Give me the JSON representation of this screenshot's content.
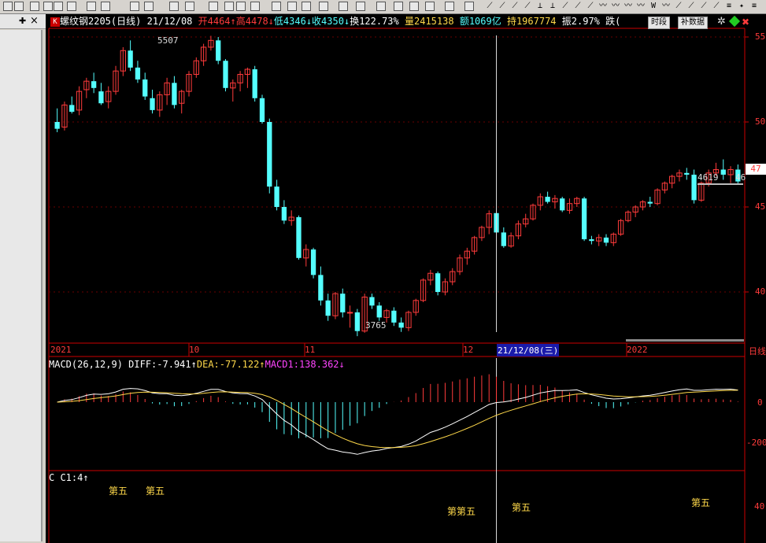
{
  "panel": {
    "pin_icon": "pin-icon",
    "close_label": "×"
  },
  "info_bar": {
    "k_badge": "K",
    "symbol": "螺纹钢2205(日线)",
    "date": "21/12/08",
    "open": "开4464",
    "open_arrow": "↑",
    "high": "高4478",
    "high_arrow": "↓",
    "low": "低4346",
    "low_arrow": "↓",
    "close": "收4350",
    "close_arrow": "↓",
    "turnover_rate": "换122.73%",
    "volume": "量2415138",
    "amount": "额1069亿",
    "open_interest": "持1967774",
    "amplitude": "振2.97%",
    "change": "跌(",
    "timeshare_btn": "时段",
    "supplement_btn": "补数据",
    "colors": {
      "up": "#ff3b3b",
      "down": "#54ffff",
      "text": "#e0e0e0",
      "highlight": "#ffd94a"
    }
  },
  "price_axis": {
    "labels": [
      "55",
      "50",
      "47",
      "45",
      "40"
    ],
    "current_price_label": "47"
  },
  "annotations": {
    "high_marker": "5507",
    "low_marker": "3765",
    "right_marker1": "4619",
    "right_marker2": "46"
  },
  "date_axis": {
    "labels": [
      "2021",
      "10",
      "11",
      "12",
      "21/12/08(三)",
      "2022"
    ],
    "right_label": "日线"
  },
  "macd": {
    "legend_name": "MACD(26,12,9)",
    "diff": "DIFF:-7.941",
    "diff_arrow": "↑",
    "dea": "DEA:-77.122",
    "dea_arrow": "↑",
    "macd1": "MACD1:138.362",
    "macd1_arrow": "↓",
    "axis_labels": [
      "0",
      "-200"
    ]
  },
  "c_indicator": {
    "legend": "C C1:4",
    "legend_arrow": "↑",
    "signal_text": "第五",
    "signal_overlap": "第第五",
    "axis_labels": [
      "40"
    ]
  },
  "chart_data": {
    "type": "candlestick",
    "title": "螺纹钢2205(日线)",
    "ylim": [
      3700,
      5600
    ],
    "marked_high": 5507,
    "marked_low": 3765,
    "selected_date": "21/12/08",
    "selected_bar": {
      "open": 4464,
      "high": 4478,
      "low": 4346,
      "close": 4350
    },
    "candles": [
      [
        5000,
        5080,
        4940,
        4960
      ],
      [
        4970,
        5120,
        4950,
        5100
      ],
      [
        5100,
        5150,
        5050,
        5060
      ],
      [
        5070,
        5210,
        5040,
        5180
      ],
      [
        5190,
        5260,
        5140,
        5240
      ],
      [
        5240,
        5290,
        5170,
        5200
      ],
      [
        5180,
        5230,
        5100,
        5110
      ],
      [
        5120,
        5210,
        5080,
        5180
      ],
      [
        5180,
        5330,
        5160,
        5300
      ],
      [
        5300,
        5440,
        5270,
        5420
      ],
      [
        5420,
        5480,
        5300,
        5320
      ],
      [
        5320,
        5360,
        5230,
        5250
      ],
      [
        5250,
        5290,
        5130,
        5150
      ],
      [
        5140,
        5190,
        5050,
        5070
      ],
      [
        5070,
        5180,
        5030,
        5160
      ],
      [
        5160,
        5260,
        5100,
        5230
      ],
      [
        5230,
        5270,
        5080,
        5100
      ],
      [
        5110,
        5190,
        5050,
        5180
      ],
      [
        5180,
        5300,
        5150,
        5280
      ],
      [
        5280,
        5380,
        5260,
        5360
      ],
      [
        5360,
        5460,
        5330,
        5440
      ],
      [
        5440,
        5507,
        5420,
        5480
      ],
      [
        5480,
        5500,
        5340,
        5360
      ],
      [
        5360,
        5370,
        5180,
        5200
      ],
      [
        5200,
        5250,
        5120,
        5230
      ],
      [
        5230,
        5300,
        5180,
        5280
      ],
      [
        5280,
        5320,
        5200,
        5310
      ],
      [
        5310,
        5330,
        5120,
        5140
      ],
      [
        5140,
        5160,
        4990,
        5000
      ],
      [
        5000,
        5020,
        4580,
        4620
      ],
      [
        4620,
        4660,
        4480,
        4500
      ],
      [
        4500,
        4540,
        4400,
        4420
      ],
      [
        4420,
        4480,
        4390,
        4440
      ],
      [
        4440,
        4450,
        4190,
        4200
      ],
      [
        4200,
        4280,
        4150,
        4250
      ],
      [
        4250,
        4260,
        4080,
        4100
      ],
      [
        4100,
        4150,
        3920,
        3950
      ],
      [
        3950,
        3990,
        3830,
        3860
      ],
      [
        3860,
        4000,
        3840,
        3990
      ],
      [
        3990,
        4020,
        3850,
        3880
      ],
      [
        3880,
        3920,
        3790,
        3880
      ],
      [
        3880,
        3900,
        3740,
        3770
      ],
      [
        3770,
        3990,
        3760,
        3970
      ],
      [
        3970,
        3990,
        3900,
        3920
      ],
      [
        3920,
        3940,
        3830,
        3850
      ],
      [
        3850,
        3900,
        3820,
        3890
      ],
      [
        3890,
        3910,
        3800,
        3820
      ],
      [
        3820,
        3850,
        3765,
        3790
      ],
      [
        3790,
        3890,
        3770,
        3880
      ],
      [
        3880,
        3960,
        3860,
        3950
      ],
      [
        3950,
        4080,
        3940,
        4070
      ],
      [
        4070,
        4130,
        4040,
        4110
      ],
      [
        4110,
        4120,
        3980,
        4000
      ],
      [
        4000,
        4080,
        3980,
        4060
      ],
      [
        4060,
        4140,
        4040,
        4120
      ],
      [
        4120,
        4220,
        4100,
        4200
      ],
      [
        4200,
        4260,
        4160,
        4240
      ],
      [
        4240,
        4330,
        4220,
        4320
      ],
      [
        4320,
        4390,
        4300,
        4380
      ],
      [
        4380,
        4480,
        4340,
        4460
      ],
      [
        4464,
        4478,
        4346,
        4350
      ],
      [
        4350,
        4380,
        4260,
        4270
      ],
      [
        4270,
        4350,
        4260,
        4330
      ],
      [
        4330,
        4420,
        4310,
        4400
      ],
      [
        4400,
        4460,
        4380,
        4430
      ],
      [
        4430,
        4520,
        4420,
        4510
      ],
      [
        4510,
        4580,
        4480,
        4560
      ],
      [
        4560,
        4590,
        4520,
        4530
      ],
      [
        4530,
        4570,
        4490,
        4550
      ],
      [
        4550,
        4560,
        4470,
        4480
      ],
      [
        4480,
        4550,
        4460,
        4520
      ],
      [
        4520,
        4560,
        4500,
        4550
      ],
      [
        4550,
        4560,
        4300,
        4310
      ],
      [
        4310,
        4330,
        4280,
        4300
      ],
      [
        4300,
        4340,
        4270,
        4320
      ],
      [
        4320,
        4340,
        4270,
        4290
      ],
      [
        4290,
        4350,
        4270,
        4340
      ],
      [
        4340,
        4430,
        4330,
        4420
      ],
      [
        4420,
        4480,
        4410,
        4470
      ],
      [
        4470,
        4510,
        4440,
        4500
      ],
      [
        4500,
        4540,
        4480,
        4530
      ],
      [
        4530,
        4560,
        4500,
        4520
      ],
      [
        4520,
        4610,
        4510,
        4600
      ],
      [
        4600,
        4650,
        4580,
        4640
      ],
      [
        4640,
        4690,
        4610,
        4680
      ],
      [
        4680,
        4720,
        4650,
        4700
      ],
      [
        4700,
        4730,
        4660,
        4690
      ],
      [
        4690,
        4720,
        4520,
        4540
      ],
      [
        4540,
        4650,
        4530,
        4640
      ],
      [
        4640,
        4720,
        4620,
        4700
      ],
      [
        4700,
        4760,
        4680,
        4720
      ],
      [
        4720,
        4780,
        4660,
        4690
      ],
      [
        4690,
        4740,
        4640,
        4720
      ],
      [
        4720,
        4750,
        4630,
        4650
      ]
    ]
  }
}
